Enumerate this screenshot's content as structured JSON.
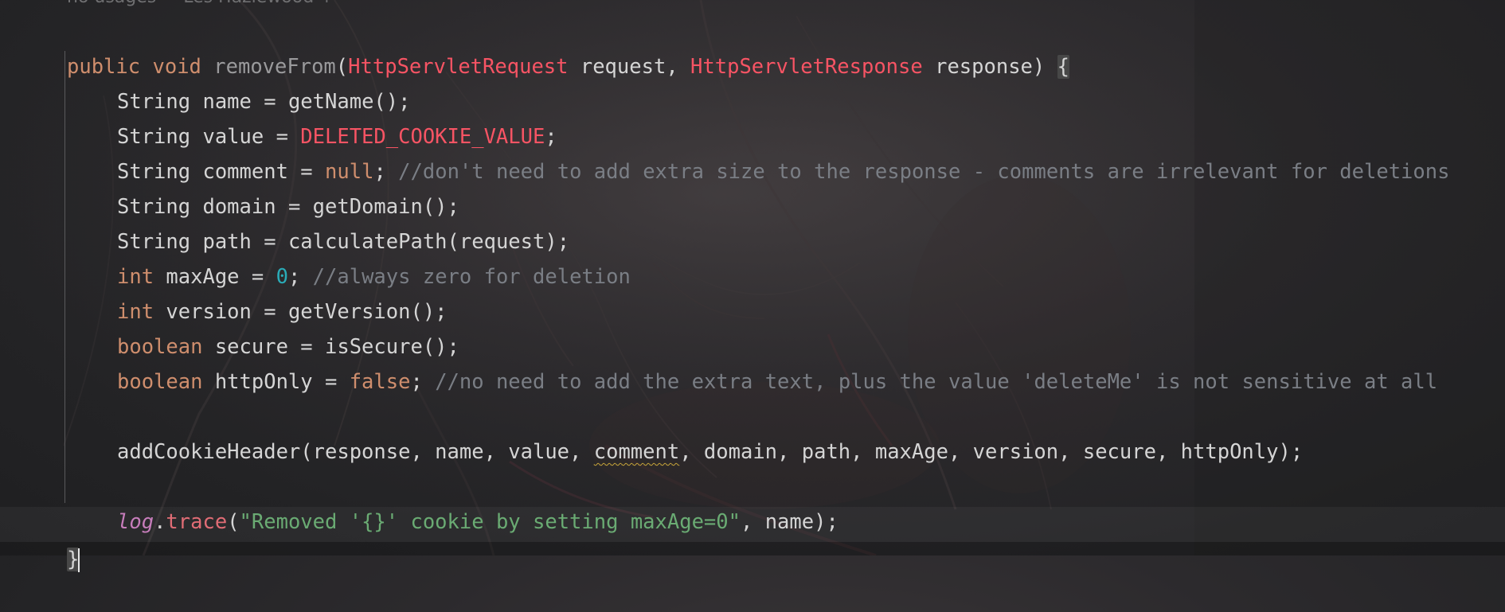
{
  "editor": {
    "usages_hint": "no usages  • Les Hazlewood +",
    "code_lines": [
      "public void removeFrom(HttpServletRequest request, HttpServletResponse response) {",
      "String name = getName();",
      "String value = DELETED_COOKIE_VALUE;",
      "String comment = null; //don't need to add extra size to the response - comments are irrelevant for deletions",
      "String domain = getDomain();",
      "String path = calculatePath(request);",
      "int maxAge = 0; //always zero for deletion",
      "int version = getVersion();",
      "boolean secure = isSecure();",
      "boolean httpOnly = false; //no need to add the extra text, plus the value 'deleteMe' is not sensitive at all",
      "",
      "addCookieHeader(response, name, value, comment, domain, path, maxAge, version, secure, httpOnly);",
      "",
      "log.trace(\"Removed '{}' cookie by setting maxAge=0\", name);",
      "}"
    ],
    "colors": {
      "keyword": "#cf8e6d",
      "class_name": "#f75464",
      "constant": "#f75464",
      "number": "#2aacb8",
      "comment": "#7a7e85",
      "string": "#6aab73",
      "log_field": "#c77dbb",
      "plain": "#d5d5d5"
    },
    "t": {
      "public": "public",
      "void": "void",
      "removeFrom": "removeFrom",
      "lp": "(",
      "HttpServletRequest": "HttpServletRequest",
      "request_comma": " request, ",
      "HttpServletResponse": "HttpServletResponse",
      "response_close": " response) ",
      "open_brace": "{",
      "close_brace": "}",
      "String": "String",
      "name_eq": " name = ",
      "getName": "getName();",
      "value_eq": " value = ",
      "DELETED_COOKIE_VALUE": "DELETED_COOKIE_VALUE",
      "semi": ";",
      "comment_eq": " comment = ",
      "null": "null",
      "semi_space": "; ",
      "comment_text_1": "//don't need to add extra size to the response - comments are irrelevant for deletions",
      "domain_eq": " domain = ",
      "getDomain": "getDomain();",
      "path_eq": " path = ",
      "calculatePath": "calculatePath(request);",
      "int": "int",
      "maxAge_eq": " maxAge = ",
      "zero": "0",
      "comment_text_2": "//always zero for deletion",
      "version_eq": " version = ",
      "getVersion": "getVersion();",
      "boolean": "boolean",
      "secure_eq": " secure = ",
      "isSecure": "isSecure();",
      "httpOnly_eq": " httpOnly = ",
      "false": "false",
      "comment_text_3": "//no need to add the extra text, plus the value 'deleteMe' is not sensitive at all",
      "addCookieHeader_pre": "addCookieHeader(response, name, value, ",
      "comment_arg": "comment",
      "addCookieHeader_post": ", domain, path, maxAge, version, secure, httpOnly);",
      "log": "log",
      "dot": ".",
      "trace": "trace",
      "trace_lp": "(",
      "trace_string": "\"Removed '{}' cookie by setting maxAge=0\"",
      "trace_end": ", name);"
    }
  }
}
